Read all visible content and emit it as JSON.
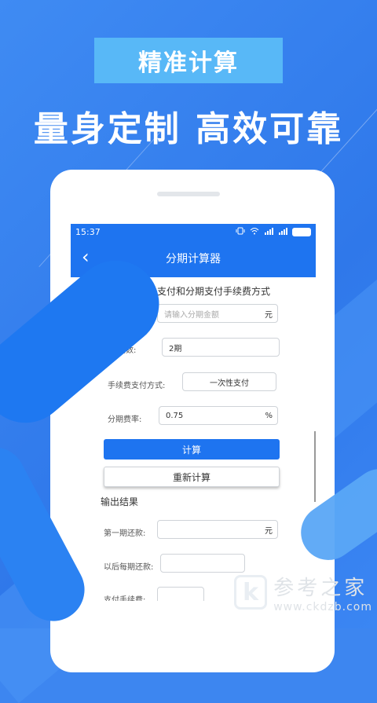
{
  "banner": {
    "tag": "精准计算",
    "slogan": "量身定制 高效可靠"
  },
  "status_bar": {
    "time": "15:37"
  },
  "app": {
    "title": "分期计算器",
    "section_title": "次性支付和分期支付手续费方式",
    "form": {
      "amount_placeholder": "请输入分期金额",
      "amount_unit": "元",
      "periods_label": "期数:",
      "periods_value": "2期",
      "fee_method_label": "手续费支付方式:",
      "fee_method_value": "一次性支付",
      "rate_label": "分期费率:",
      "rate_value": "0.75",
      "rate_unit": "%"
    },
    "buttons": {
      "calculate": "计算",
      "reset": "重新计算"
    },
    "output": {
      "title": "输出结果",
      "first_payment_label": "第一期还款:",
      "first_payment_unit": "元",
      "later_payment_label": "以后每期还款:",
      "fee_label": "支付手续费:"
    }
  },
  "watermark": {
    "logo_letter": "k",
    "name": "参考之家",
    "url": "www.ckdzb.com"
  },
  "colors": {
    "primary": "#1e74f0",
    "tag_bg": "#58b8f7",
    "background": "#3d86f0"
  }
}
